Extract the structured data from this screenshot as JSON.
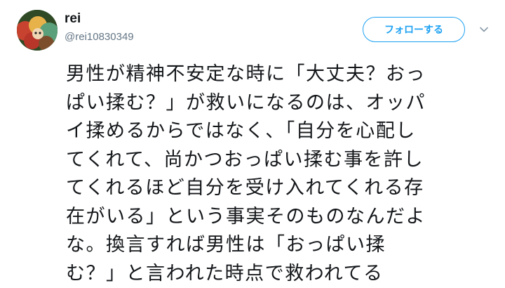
{
  "user": {
    "display_name": "rei",
    "handle": "@rei10830349",
    "avatar": "avatar-image"
  },
  "actions": {
    "follow_label": "フォローする",
    "more_icon": "chevron-down-icon"
  },
  "colors": {
    "accent": "#1da1f2",
    "text": "#14171a",
    "secondary_text": "#657786"
  },
  "tweet": {
    "lines": [
      "男性が精神不安定な時に「大丈夫？おっ",
      "ぱい揉む？」が救いになるのは、オッパ",
      "イ揉めるからではなく、「自分を心配し",
      "てくれて、尚かつおっぱい揉む事を許し",
      "てくれるほど自分を受け入れてくれる存",
      "在がいる」という事実そのものなんだよ",
      "な。換言すれば男性は「おっぱい揉",
      "む？」と言われた時点で救われてる"
    ]
  }
}
